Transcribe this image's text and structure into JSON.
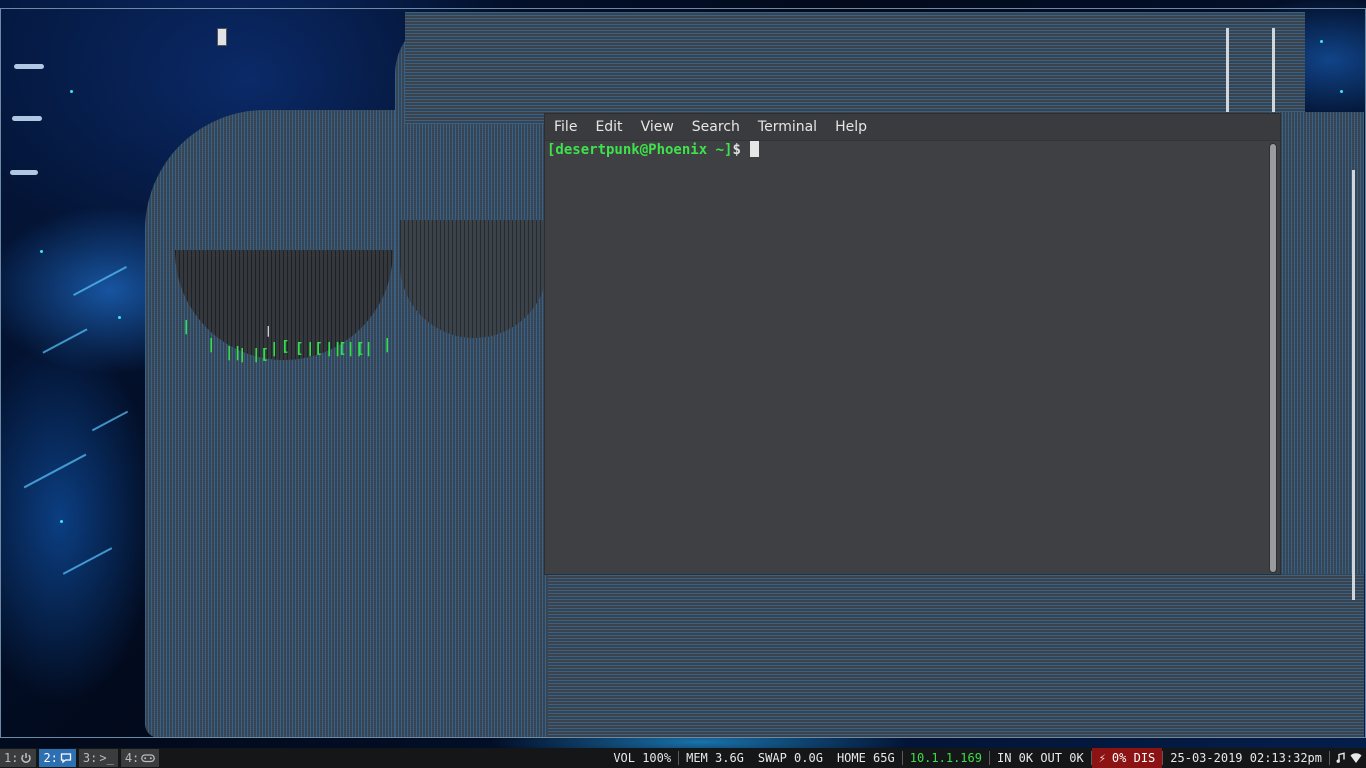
{
  "terminal": {
    "menu": [
      "File",
      "Edit",
      "View",
      "Search",
      "Terminal",
      "Help"
    ],
    "prompt_user": "[desertpunk@Phoenix ~]",
    "prompt_symbol": "$"
  },
  "glitch_glyphs": [
    "|",
    "|",
    "||",
    "|",
    "|[",
    "|",
    "[",
    "[",
    "|[",
    "||",
    "[||",
    "[|",
    "|",
    "|",
    "|"
  ],
  "workspaces": [
    {
      "label": "1:",
      "icon": "power-icon",
      "active": false
    },
    {
      "label": "2:",
      "icon": "chat-icon",
      "active": true
    },
    {
      "label": "3:",
      "icon": "terminal-prompt-icon",
      "active": false,
      "suffix": ">_"
    },
    {
      "label": "4:",
      "icon": "gamepad-icon",
      "active": false
    }
  ],
  "status": {
    "volume": "VOL 100%",
    "memory": "MEM 3.6G",
    "swap": "SWAP 0.0G",
    "home": "HOME 65G",
    "ip": "10.1.1.169",
    "network": "IN 0K OUT 0K",
    "battery": "0% DIS",
    "datetime": "25-03-2019 02:13:32pm"
  },
  "colors": {
    "prompt_green": "#3ee24b",
    "active_workspace": "#2d6fb3",
    "battery_bg": "#8c1313",
    "terminal_bg": "#3f4044"
  }
}
